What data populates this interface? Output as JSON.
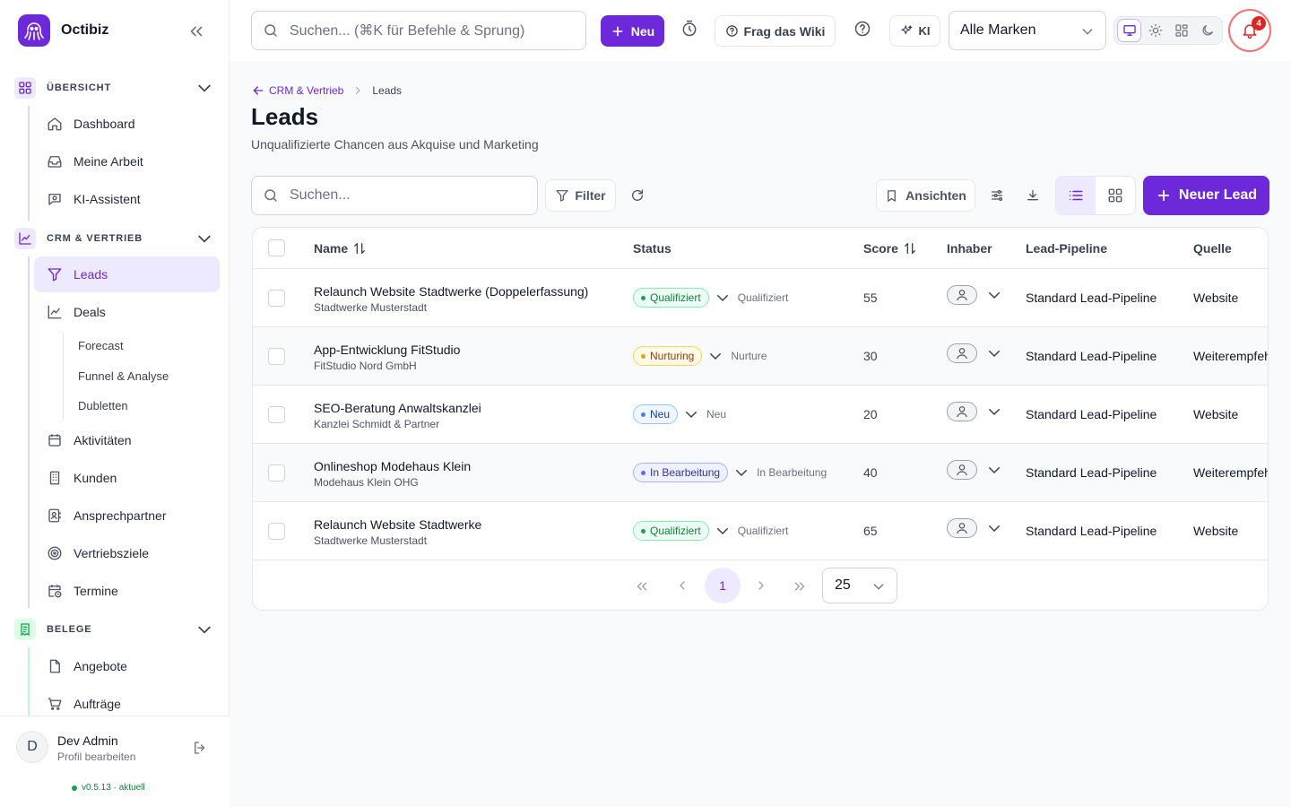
{
  "app": {
    "name": "Octibiz"
  },
  "sidebar": {
    "sections": [
      {
        "label": "ÜBERSICHT"
      },
      {
        "label": "CRM & VERTRIEB"
      },
      {
        "label": "BELEGE"
      }
    ],
    "overview_items": [
      "Dashboard",
      "Meine Arbeit",
      "KI-Assistent"
    ],
    "crm_items": {
      "leads": "Leads",
      "deals": "Deals",
      "deal_sub": [
        "Forecast",
        "Funnel & Analyse",
        "Dubletten"
      ],
      "more": [
        "Aktivitäten",
        "Kunden",
        "Ansprechpartner",
        "Vertriebsziele",
        "Termine"
      ]
    },
    "beleg_items": [
      "Angebote",
      "Aufträge"
    ],
    "user": {
      "initial": "D",
      "name": "Dev Admin",
      "sub": "Profil bearbeiten"
    },
    "version": "v0.5.13 · aktuell"
  },
  "topbar": {
    "search_placeholder": "Suchen... (⌘K für Befehle & Sprung)",
    "new_label": "Neu",
    "wiki_label": "Frag das Wiki",
    "ki_label": "KI",
    "brand_select": "Alle Marken",
    "notifications": "4"
  },
  "page": {
    "breadcrumb_parent": "CRM & Vertrieb",
    "breadcrumb_current": "Leads",
    "title": "Leads",
    "subtitle": "Unqualifizierte Chancen aus Akquise und Marketing"
  },
  "toolbar": {
    "search_placeholder": "Suchen...",
    "filter_label": "Filter",
    "views_label": "Ansichten",
    "new_lead_label": "Neuer Lead"
  },
  "table": {
    "columns": {
      "name": "Name",
      "status": "Status",
      "score": "Score",
      "owner": "Inhaber",
      "pipeline": "Lead-Pipeline",
      "source": "Quelle"
    },
    "rows": [
      {
        "name": "Relaunch Website Stadtwerke (Doppelerfassung)",
        "company": "Stadtwerke Musterstadt",
        "status": "Qualifiziert",
        "status_color": "green",
        "stage": "Qualifiziert",
        "score": "55",
        "pipeline": "Standard Lead-Pipeline",
        "source": "Website"
      },
      {
        "name": "App-Entwicklung FitStudio",
        "company": "FitStudio Nord GmbH",
        "status": "Nurturing",
        "status_color": "orange",
        "stage": "Nurture",
        "score": "30",
        "pipeline": "Standard Lead-Pipeline",
        "source": "Weiterempfehlung"
      },
      {
        "name": "SEO-Beratung Anwaltskanzlei",
        "company": "Kanzlei Schmidt & Partner",
        "status": "Neu",
        "status_color": "blue",
        "stage": "Neu",
        "score": "20",
        "pipeline": "Standard Lead-Pipeline",
        "source": "Website"
      },
      {
        "name": "Onlineshop Modehaus Klein",
        "company": "Modehaus Klein OHG",
        "status": "In Bearbeitung",
        "status_color": "indigo",
        "stage": "In Bearbeitung",
        "score": "40",
        "pipeline": "Standard Lead-Pipeline",
        "source": "Weiterempfehlung"
      },
      {
        "name": "Relaunch Website Stadtwerke",
        "company": "Stadtwerke Musterstadt",
        "status": "Qualifiziert",
        "status_color": "green",
        "stage": "Qualifiziert",
        "score": "65",
        "pipeline": "Standard Lead-Pipeline",
        "source": "Website"
      }
    ]
  },
  "pagination": {
    "current": "1",
    "page_size": "25"
  },
  "colors": {
    "accent": "#6d28d9",
    "accent_soft": "#ede9fe"
  }
}
